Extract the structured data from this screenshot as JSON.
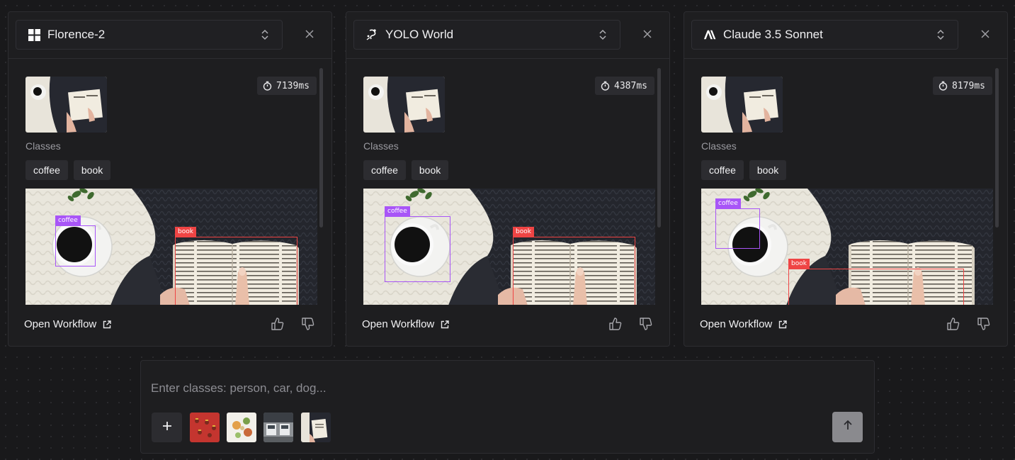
{
  "panels": [
    {
      "model_name": "Florence-2",
      "logo_icon": "windows-grid-icon",
      "time": "7139ms",
      "classes_label": "Classes",
      "classes": [
        "coffee",
        "book"
      ],
      "detections": [
        {
          "label": "coffee",
          "color": "#a855f7"
        },
        {
          "label": "book",
          "color": "#ef4444"
        }
      ],
      "open_workflow": "Open Workflow"
    },
    {
      "model_name": "YOLO World",
      "logo_icon": "yolo-world-icon",
      "time": "4387ms",
      "classes_label": "Classes",
      "classes": [
        "coffee",
        "book"
      ],
      "detections": [
        {
          "label": "coffee",
          "color": "#a855f7"
        },
        {
          "label": "book",
          "color": "#ef4444"
        }
      ],
      "open_workflow": "Open Workflow"
    },
    {
      "model_name": "Claude 3.5 Sonnet",
      "logo_icon": "anthropic-icon",
      "time": "8179ms",
      "classes_label": "Classes",
      "classes": [
        "coffee",
        "book"
      ],
      "detections": [
        {
          "label": "coffee",
          "color": "#a855f7"
        },
        {
          "label": "book",
          "color": "#ef4444"
        }
      ],
      "open_workflow": "Open Workflow"
    }
  ],
  "composer": {
    "placeholder": "Enter classes: person, car, dog...",
    "value": "",
    "samples": [
      "red-pattern-image",
      "food-image",
      "trucks-image",
      "book-image"
    ]
  },
  "colors": {
    "background": "#19191b",
    "panel": "#1e1e20",
    "chip": "#2c2c30",
    "coffee_box": "#a855f7",
    "book_box": "#ef4444",
    "send_button": "#8a8a8e"
  }
}
